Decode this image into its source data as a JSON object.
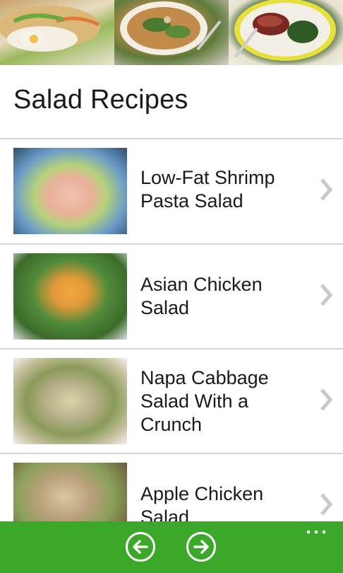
{
  "header": {
    "title": "Salad Recipes",
    "photos": [
      {
        "icon": "sandwich-photo-icon"
      },
      {
        "icon": "salad-bowl-photo-icon"
      },
      {
        "icon": "steak-plate-photo-icon"
      }
    ]
  },
  "recipes": [
    {
      "lines": [
        "Low-Fat Shrimp",
        "Pasta Salad"
      ],
      "icon": "shrimp-pasta-salad-photo"
    },
    {
      "lines": [
        "Asian Chicken",
        "Salad"
      ],
      "icon": "asian-chicken-salad-photo"
    },
    {
      "lines": [
        "Napa Cabbage",
        "Salad With a",
        "Crunch"
      ],
      "icon": "napa-cabbage-salad-photo"
    },
    {
      "lines": [
        "Apple Chicken",
        "Salad"
      ],
      "icon": "apple-chicken-salad-photo"
    }
  ],
  "app_bar": {
    "buttons": [
      {
        "icon": "back-arrow-icon"
      },
      {
        "icon": "forward-arrow-icon"
      }
    ],
    "more_icon": "more-dots-icon",
    "color": "#3ca82a"
  },
  "colors": {
    "divider": "#d6d6d6",
    "text": "#1a1a1a",
    "chevron": "#c8c8c8"
  }
}
